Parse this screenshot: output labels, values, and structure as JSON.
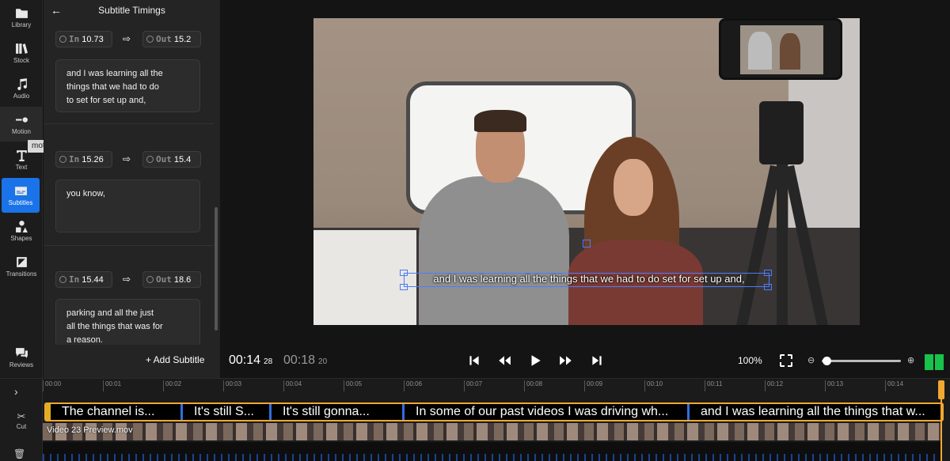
{
  "rail": {
    "items": [
      {
        "label": "Library",
        "icon": "folder-icon"
      },
      {
        "label": "Stock",
        "icon": "books-icon"
      },
      {
        "label": "Audio",
        "icon": "music-note-icon"
      },
      {
        "label": "Motion",
        "icon": "motion-icon"
      },
      {
        "label": "Text",
        "icon": "text-icon"
      },
      {
        "label": "Subtitles",
        "icon": "subtitles-icon"
      },
      {
        "label": "Shapes",
        "icon": "shapes-icon"
      },
      {
        "label": "Transitions",
        "icon": "transitions-icon"
      }
    ],
    "reviews_label": "Reviews",
    "tooltip": "motion",
    "active": "Subtitles"
  },
  "panel": {
    "title": "Subtitle Timings",
    "in_label": "In",
    "out_label": "Out",
    "entries": [
      {
        "in": "10.73",
        "out": "15.2",
        "text": "and I was learning all the\nthings that we had to do\nto set for set up and,"
      },
      {
        "in": "15.26",
        "out": "15.4",
        "text": "you know,"
      },
      {
        "in": "15.44",
        "out": "18.6",
        "text": "parking and all the just\nall the things that was for\na reason."
      }
    ],
    "add_label": "+ Add Subtitle"
  },
  "preview": {
    "caption": "and I was learning all the things that we had to do set for set up and,"
  },
  "transport": {
    "current_time": "00:14",
    "current_frames": "28",
    "total_time": "00:18",
    "total_frames": "20",
    "zoom": "100%",
    "zoom_level": 0.05
  },
  "timeline": {
    "ruler_ticks": [
      "00:00",
      "00:01",
      "00:02",
      "00:03",
      "00:04",
      "00:05",
      "00:06",
      "00:07",
      "00:08",
      "00:09",
      "00:10",
      "00:11",
      "00:12",
      "00:13",
      "00:14"
    ],
    "subtitle_clips": [
      "The channel is...",
      "It's still S...",
      "It's still gonna...",
      "In some of our past videos I was driving wh...",
      "and I was learning all the things that w..."
    ],
    "video_label": "Video 23 Preview.mov",
    "cut_label": "Cut",
    "accent_color": "#f0a830",
    "clip_edge_color": "#2f6fe0"
  }
}
